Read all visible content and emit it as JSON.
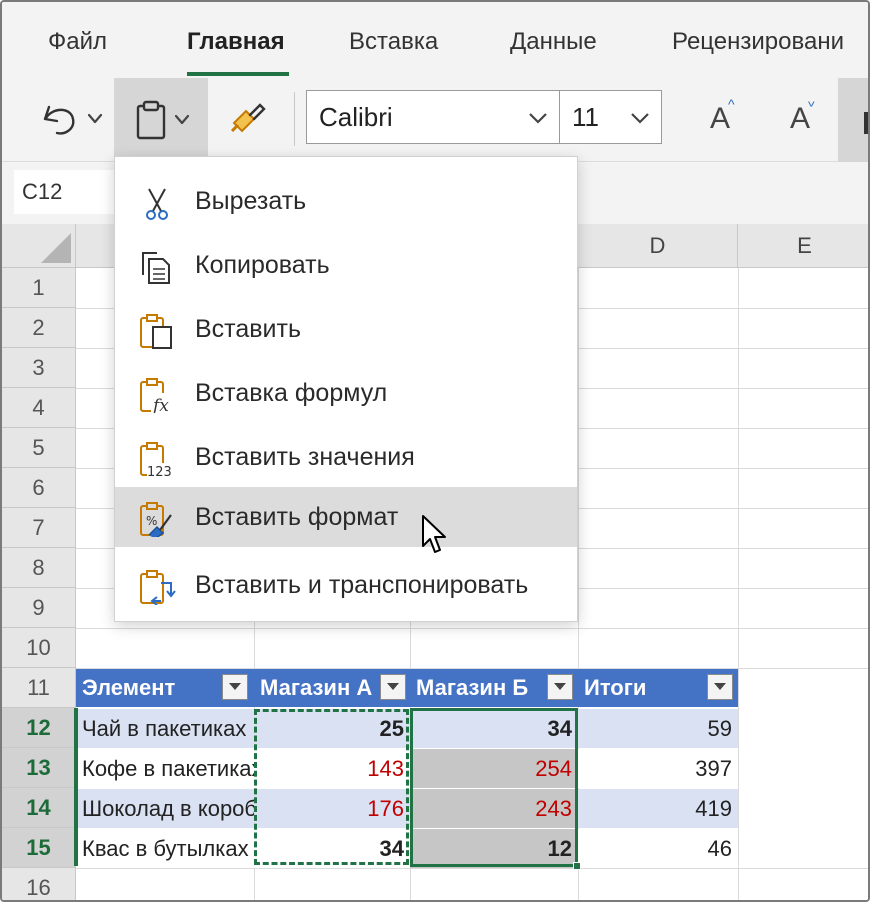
{
  "ribbon": {
    "tabs": [
      {
        "label": "Файл"
      },
      {
        "label": "Главная",
        "active": true
      },
      {
        "label": "Вставка"
      },
      {
        "label": "Данные"
      },
      {
        "label": "Рецензировани"
      }
    ],
    "accent_color": "#217346"
  },
  "toolbar": {
    "undo_icon": "undo-icon",
    "paste_icon": "clipboard-icon",
    "format_painter_icon": "format-painter-icon",
    "font_name": "Calibri",
    "font_size": "11",
    "grow_font": "A",
    "shrink_font": "A"
  },
  "name_box": "C12",
  "paste_menu": {
    "items": [
      {
        "label": "Вырезать",
        "icon": "scissors-icon"
      },
      {
        "label": "Копировать",
        "icon": "copy-icon"
      },
      {
        "label": "Вставить",
        "icon": "paste-icon"
      },
      {
        "label": "Вставка формул",
        "icon": "paste-formulas-icon"
      },
      {
        "label": "Вставить значения",
        "icon": "paste-values-icon"
      },
      {
        "label": "Вставить формат",
        "icon": "paste-formatting-icon",
        "highlighted": true
      },
      {
        "label": "Вставить и транспонировать",
        "icon": "paste-transpose-icon"
      }
    ]
  },
  "sheet": {
    "columns": [
      "D",
      "E"
    ],
    "rows": [
      "1",
      "2",
      "3",
      "4",
      "5",
      "6",
      "7",
      "8",
      "9",
      "10",
      "11",
      "12",
      "13",
      "14",
      "15",
      "16"
    ],
    "selected_rows": [
      "12",
      "13",
      "14",
      "15"
    ],
    "table": {
      "headers": [
        "Элемент",
        "Магазин А",
        "Магазин Б",
        "Итоги"
      ],
      "rows": [
        {
          "item": "Чай в пакетиках",
          "a": "25",
          "b": "34",
          "total": "59"
        },
        {
          "item": "Кофе в пакетиках",
          "a": "143",
          "b": "254",
          "total": "397"
        },
        {
          "item": "Шоколад в коробке",
          "a": "176",
          "b": "243",
          "total": "419"
        },
        {
          "item": "Квас в бутылках",
          "a": "34",
          "b": "12",
          "total": "46"
        }
      ],
      "header_color": "#4472c4",
      "band_color": "#d9e1f2",
      "negative_color": "#c00000"
    }
  }
}
